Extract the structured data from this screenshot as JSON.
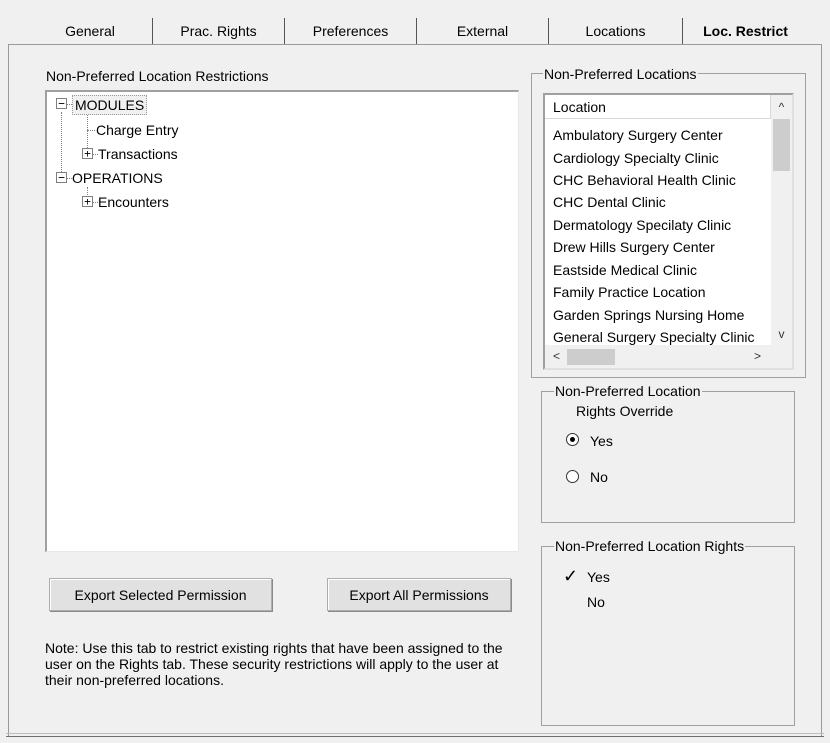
{
  "tabs": [
    {
      "label": "General",
      "active": false
    },
    {
      "label": "Prac. Rights",
      "active": false
    },
    {
      "label": "Preferences",
      "active": false
    },
    {
      "label": "External",
      "active": false
    },
    {
      "label": "Locations",
      "active": false
    },
    {
      "label": "Loc. Restrict",
      "active": true
    }
  ],
  "restrictions": {
    "title": "Non-Preferred Location Restrictions",
    "tree": {
      "modules": "MODULES",
      "charge_entry": "Charge Entry",
      "transactions": "Transactions",
      "operations": "OPERATIONS",
      "encounters": "Encounters"
    },
    "expander_minus": "−",
    "expander_plus": "+"
  },
  "buttons": {
    "export_selected": "Export Selected Permission",
    "export_all": "Export All Permissions"
  },
  "note": "Note: Use this tab to restrict existing rights that have been assigned to the user on the Rights tab.  These security restrictions will apply to the user at their non-preferred locations.",
  "locations": {
    "title": "Non-Preferred Locations",
    "column_header": "Location",
    "items": [
      "Ambulatory Surgery Center",
      "Cardiology Specialty Clinic",
      "CHC Behavioral Health Clinic",
      "CHC Dental Clinic",
      "Dermatology Specilaty Clinic",
      "Drew Hills Surgery Center",
      "Eastside Medical Clinic",
      "Family Practice Location",
      "Garden Springs Nursing Home",
      "General Surgery Specialty Clinic"
    ],
    "scroll_up": "^",
    "scroll_down": "v",
    "scroll_left": "<",
    "scroll_right": ">"
  },
  "override": {
    "title_line1": "Non-Preferred Location",
    "title_line2": "Rights Override",
    "yes": "Yes",
    "no": "No",
    "selected": "Yes"
  },
  "rights": {
    "title": "Non-Preferred Location Rights",
    "checkmark": "✓",
    "yes": "Yes",
    "no": "No"
  }
}
